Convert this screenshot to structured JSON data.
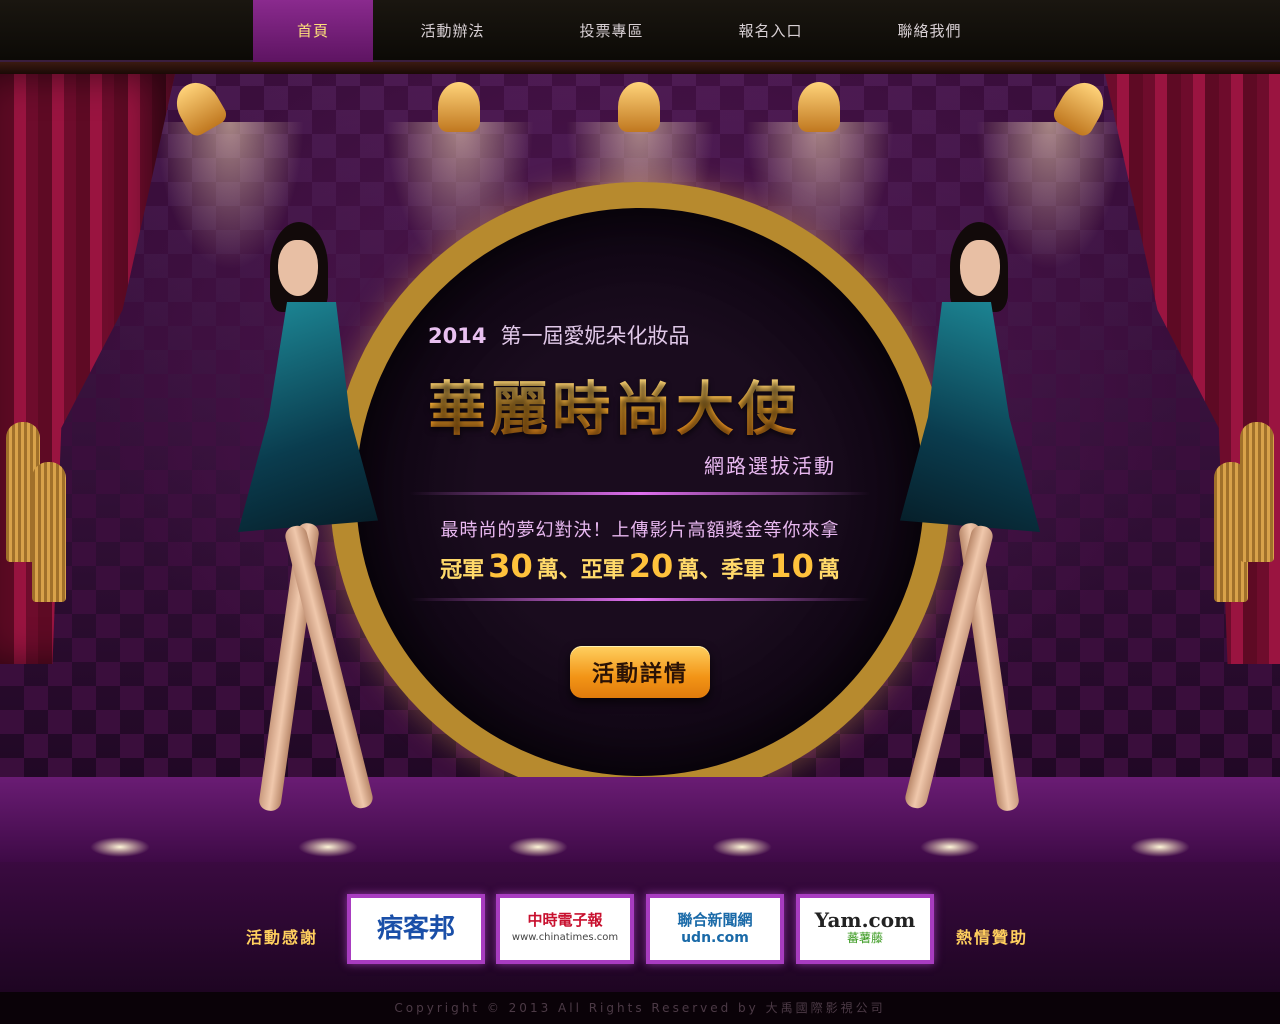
{
  "nav": {
    "items": [
      {
        "label": "首頁",
        "active": true
      },
      {
        "label": "活動辦法",
        "active": false
      },
      {
        "label": "投票專區",
        "active": false
      },
      {
        "label": "報名入口",
        "active": false
      },
      {
        "label": "聯絡我們",
        "active": false
      }
    ]
  },
  "hero": {
    "year": "2014",
    "event_name": "第一屆愛妮朵化妝品",
    "main_title": "華麗時尚大使",
    "title_tag": "網路選拔活動",
    "tagline": "最時尚的夢幻對決！上傳影片高額獎金等你來拿",
    "prizes": {
      "first_label": "冠軍",
      "first_amount": "30",
      "first_unit": "萬、",
      "second_label": "亞軍",
      "second_amount": "20",
      "second_unit": "萬、",
      "third_label": "季軍",
      "third_amount": "10",
      "third_unit": "萬"
    },
    "details_button": "活動詳情"
  },
  "sponsors": {
    "left_label": "活動感謝",
    "right_label": "熱情贊助",
    "logos": [
      {
        "name": "痞客邦",
        "sub": ""
      },
      {
        "name": "中時電子報",
        "sub": "www.chinatimes.com"
      },
      {
        "name": "聯合新聞網",
        "sub": "udn.com"
      },
      {
        "name": "Yam.com",
        "sub": "蕃薯藤"
      }
    ]
  },
  "footer": {
    "copyright": "Copyright © 2013 All Rights Reserved by 大禹國際影視公司"
  },
  "colors": {
    "nav_active": "#7a2180",
    "gold": "#ffcf5e",
    "button_orange": "#f29416",
    "logo_border": "#a83cc0"
  }
}
